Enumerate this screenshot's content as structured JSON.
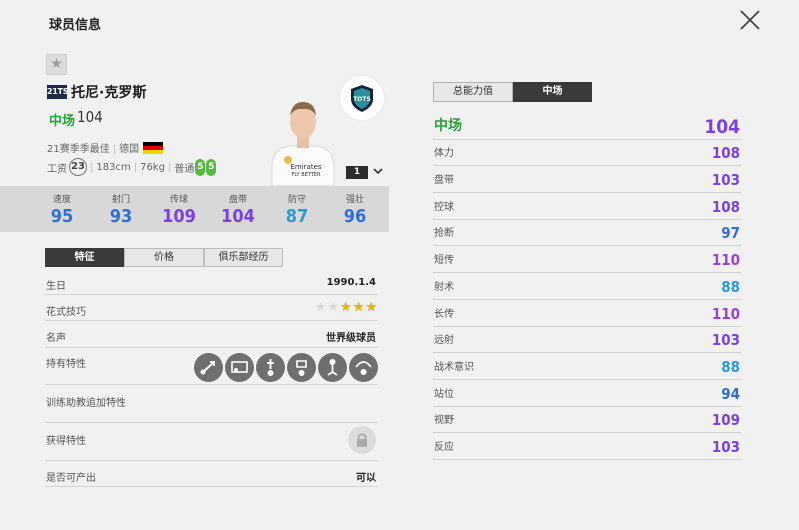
{
  "page": {
    "title": "球员信息"
  },
  "player": {
    "season_badge": "21TS",
    "name": "托尼·克罗斯",
    "position": "中场",
    "overall": "104",
    "season_text": "21赛季季最佳",
    "country": "德国",
    "wage_label": "工资",
    "wage": "23",
    "height": "183cm",
    "weight": "76kg",
    "body_type": "普通",
    "left_foot": "5",
    "right_foot": "5",
    "team_logo_text": "TOTS",
    "enhance_level": "1"
  },
  "colors": {
    "purple": "#7b3fe4",
    "blue": "#2f6fd6",
    "cyan": "#2e9ad0",
    "violet": "#a03fe0",
    "green": "#2ca23a"
  },
  "summary_stats": [
    {
      "label": "速度",
      "value": "95",
      "color": "#2f6fd6"
    },
    {
      "label": "射门",
      "value": "93",
      "color": "#2f6fd6"
    },
    {
      "label": "传球",
      "value": "109",
      "color": "#7b3fe4"
    },
    {
      "label": "盘带",
      "value": "104",
      "color": "#7b3fe4"
    },
    {
      "label": "防守",
      "value": "87",
      "color": "#2e9ad0"
    },
    {
      "label": "强壮",
      "value": "96",
      "color": "#2f6fd6"
    }
  ],
  "left_tabs": [
    "特征",
    "价格",
    "俱乐部经历"
  ],
  "info": {
    "birth_label": "生日",
    "birth": "1990.1.4",
    "skill_label": "花式技巧",
    "skill_stars": 3,
    "fame_label": "名声",
    "fame": "世界级球员",
    "traits_label": "持有特性",
    "trait_icons": [
      "long-pass-icon",
      "finesse-shot-icon",
      "playmaker-icon",
      "long-shot-icon",
      "power-header-icon",
      "through-ball-icon"
    ],
    "coach_label": "训练助教追加特性",
    "acquired_label": "获得特性",
    "producible_label": "是否可产出",
    "producible": "可以"
  },
  "right_tabs": [
    "总能力值",
    "中场"
  ],
  "detail": {
    "header": {
      "label": "中场",
      "value": "104",
      "color": "#7b3fe4"
    },
    "rows": [
      {
        "label": "体力",
        "value": "108",
        "color": "#7b3fe4"
      },
      {
        "label": "盘带",
        "value": "103",
        "color": "#7b3fe4"
      },
      {
        "label": "控球",
        "value": "108",
        "color": "#7b3fe4"
      },
      {
        "label": "抢断",
        "value": "97",
        "color": "#2f6fd6"
      },
      {
        "label": "短传",
        "value": "110",
        "color": "#a03fe0"
      },
      {
        "label": "射术",
        "value": "88",
        "color": "#2e9ad0"
      },
      {
        "label": "长传",
        "value": "110",
        "color": "#a03fe0"
      },
      {
        "label": "远射",
        "value": "103",
        "color": "#7b3fe4"
      },
      {
        "label": "战术意识",
        "value": "88",
        "color": "#2e9ad0"
      },
      {
        "label": "站位",
        "value": "94",
        "color": "#2f6fd6"
      },
      {
        "label": "视野",
        "value": "109",
        "color": "#7b3fe4"
      },
      {
        "label": "反应",
        "value": "103",
        "color": "#7b3fe4"
      }
    ]
  }
}
